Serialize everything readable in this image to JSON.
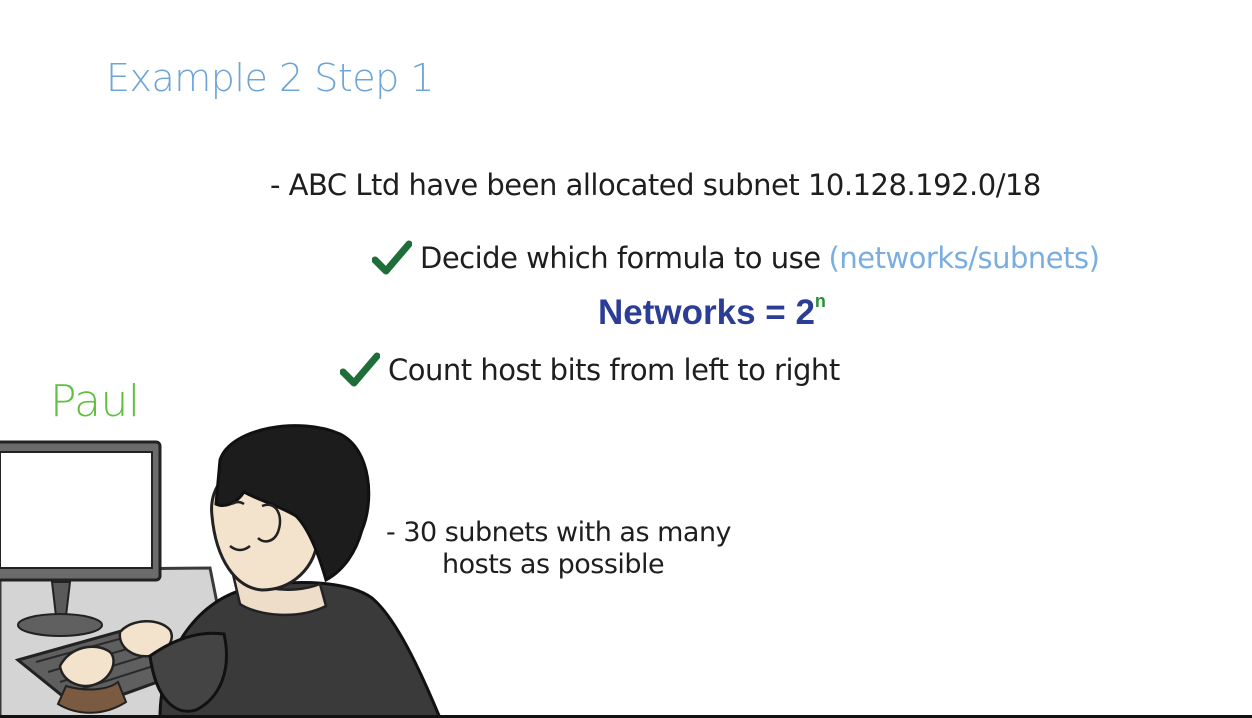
{
  "slide": {
    "title": "Example 2 Step 1",
    "line1": "- ABC Ltd have been allocated subnet 10.128.192.0/18",
    "line2_text": "Decide which formula to use",
    "line2_hint": "(networks/subnets)",
    "formula_base": "Networks = 2",
    "formula_exp": "n",
    "line3_text": "Count host bits from left to right",
    "character_name": "Paul",
    "note_line1": "- 30 subnets with as many",
    "note_line2": "hosts as possible"
  },
  "icons": {
    "check": "check-mark-icon",
    "character": "paul-at-computer-illustration"
  },
  "colors": {
    "title": "#6fa5d6",
    "hint": "#7aaee0",
    "formula": "#2b3d94",
    "exponent": "#2a8f36",
    "check": "#1f6e3a",
    "name": "#5fbf3f"
  }
}
